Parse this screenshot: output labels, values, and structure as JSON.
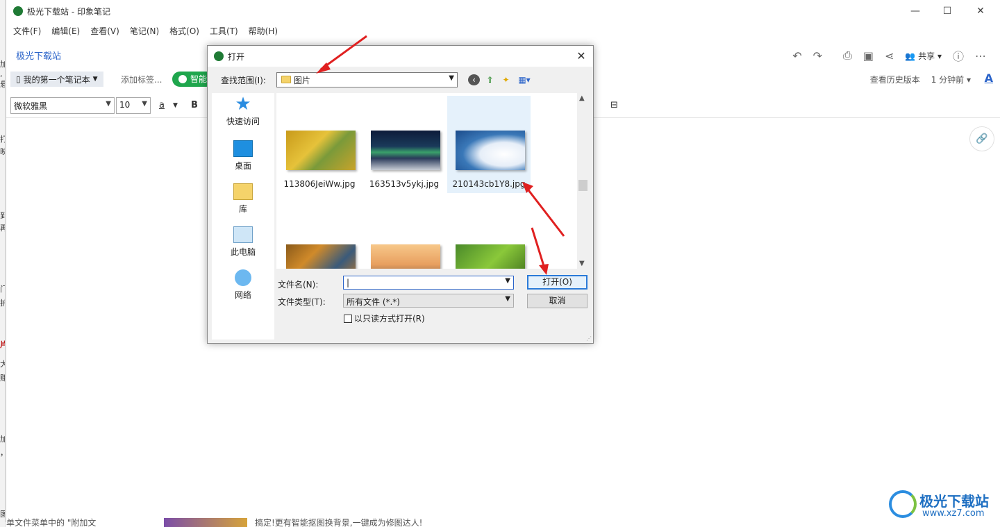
{
  "window": {
    "title": "极光下载站 - 印象笔记",
    "controls": {
      "minimize": "—",
      "maximize": "☐",
      "close": "✕"
    }
  },
  "menu": [
    "文件(F)",
    "编辑(E)",
    "查看(V)",
    "笔记(N)",
    "格式(O)",
    "工具(T)",
    "帮助(H)"
  ],
  "note": {
    "title": "极光下载站",
    "share_label": "共享",
    "notebook": "我的第一个笔记本",
    "add_tag": "添加标签...",
    "smart_label": "智能",
    "history": "查看历史版本",
    "time": "1 分钟前",
    "font_icon": "A"
  },
  "format": {
    "font": "微软雅黑",
    "size": "10",
    "color_btn": "a",
    "bold": "B"
  },
  "left_strip": [
    "加",
    ",悬",
    "打",
    "映",
    "到",
    "再",
    "门",
    "护",
    "片",
    "大",
    "赚",
    "加",
    "，",
    "图"
  ],
  "bottom": {
    "left_text": "单文件菜单中的 \"附加文",
    "text": "搞定!更有智能抠图换背景,一键成为修图达人!"
  },
  "dialog": {
    "title": "打开",
    "close": "✕",
    "lookin_label": "查找范围(I):",
    "lookin_value": "图片",
    "places": [
      {
        "label": "快速访问",
        "icon": "star-icon"
      },
      {
        "label": "桌面",
        "icon": "desktop-icon"
      },
      {
        "label": "库",
        "icon": "library-icon"
      },
      {
        "label": "此电脑",
        "icon": "computer-icon"
      },
      {
        "label": "网络",
        "icon": "network-icon"
      }
    ],
    "files": [
      {
        "name": "113806JeiWw.jpg",
        "selected": false
      },
      {
        "name": "163513v5ykj.jpg",
        "selected": false
      },
      {
        "name": "210143cb1Y8.jpg",
        "selected": true
      },
      {
        "name": "",
        "selected": false
      },
      {
        "name": "",
        "selected": false
      },
      {
        "name": "",
        "selected": false
      }
    ],
    "filename_label": "文件名(N):",
    "filename_value": "",
    "filetype_label": "文件类型(T):",
    "filetype_value": "所有文件 (*.*)",
    "open_button": "打开(O)",
    "cancel_button": "取消",
    "readonly_label": "以只读方式打开(R)"
  },
  "watermark": {
    "name": "极光下载站",
    "url": "www.xz7.com"
  },
  "colors": {
    "accent": "#2a63c9",
    "arrow": "#e02020",
    "green": "#1fa64d"
  }
}
